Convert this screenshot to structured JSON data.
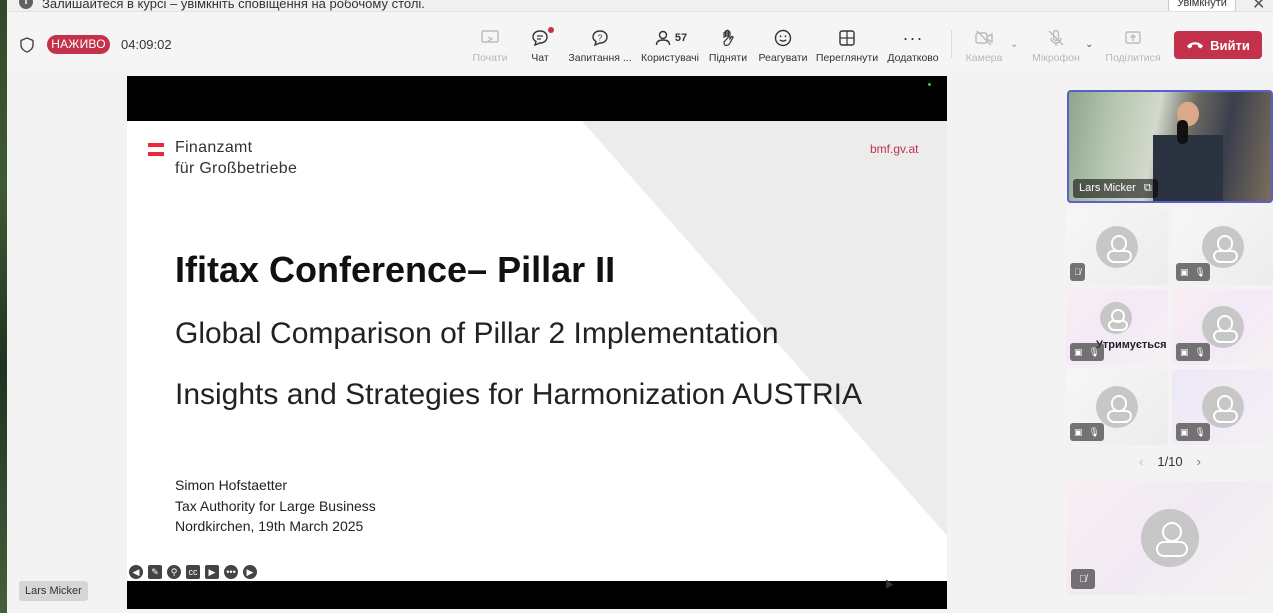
{
  "banner": {
    "text": "Залишайтеся в курсі – увімкніть сповіщення на робочому столі.",
    "enable_label": "Увімкнути"
  },
  "meeting": {
    "live_label": "НАЖИВО",
    "timer": "04:09:02"
  },
  "toolbar": {
    "tools": [
      {
        "label": "Почати",
        "icon": "share-screen-icon",
        "disabled": true
      },
      {
        "label": "Чат",
        "icon": "chat-icon",
        "disabled": false
      },
      {
        "label": "Запитання ...",
        "icon": "qna-icon",
        "disabled": false
      },
      {
        "label": "Користувачі",
        "icon": "people-icon",
        "count": "57",
        "disabled": false
      },
      {
        "label": "Підняти",
        "icon": "raise-hand-icon",
        "disabled": false
      },
      {
        "label": "Реагувати",
        "icon": "smile-icon",
        "disabled": false
      },
      {
        "label": "Переглянути",
        "icon": "view-grid-icon",
        "disabled": false
      },
      {
        "label": "Додатково",
        "icon": "more-icon",
        "disabled": false
      },
      {
        "label": "Камера",
        "icon": "camera-off-icon",
        "disabled": true
      },
      {
        "label": "Мікрофон",
        "icon": "mic-off-icon",
        "disabled": true
      },
      {
        "label": "Поділитися",
        "icon": "share-tray-icon",
        "disabled": true
      }
    ],
    "leave_label": "Вийти"
  },
  "slide": {
    "org_line1": "Finanzamt",
    "org_line2": "für Großbetriebe",
    "url": "bmf.gv.at",
    "title": "Ifitax Conference– Pillar II",
    "subtitle1": "Global Comparison of Pillar 2 Implementation",
    "subtitle2": "Insights and Strategies for Harmonization AUSTRIA",
    "author_lines": [
      "Simon Hofstaetter",
      "Tax Authority for Large Business",
      "Nordkirchen, 19th March 2025"
    ]
  },
  "presenter_name": "Lars Micker",
  "gallery": {
    "speaker_name": "Lars Micker",
    "hold_text": "Утримується",
    "page": "1/10"
  },
  "colors": {
    "live_red": "#c4314b",
    "accent_purple": "#5b5fc7",
    "austria_red": "#ed2939"
  }
}
